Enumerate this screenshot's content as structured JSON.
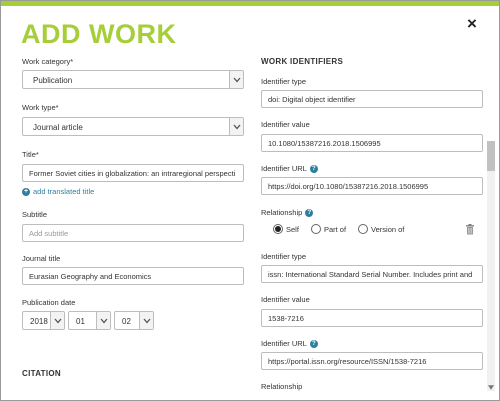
{
  "dialog": {
    "title": "ADD WORK",
    "close_symbol": "×"
  },
  "left": {
    "work_category": {
      "label": "Work category",
      "required_mark": "*",
      "value": "Publication"
    },
    "work_type": {
      "label": "Work type",
      "required_mark": "*",
      "value": "Journal article"
    },
    "title": {
      "label": "Title",
      "required_mark": "*",
      "value": "Former Soviet cities in globalization: an intraregional perspecti"
    },
    "add_translated_title": "add translated title",
    "subtitle": {
      "label": "Subtitle",
      "placeholder": "Add subtitle"
    },
    "journal_title": {
      "label": "Journal title",
      "value": "Eurasian Geography and Economics"
    },
    "publication_date": {
      "label": "Publication date",
      "year": "2018",
      "month": "01",
      "day": "02"
    },
    "citation_heading": "CITATION"
  },
  "right": {
    "heading": "WORK IDENTIFIERS",
    "identifier_1": {
      "type_label": "Identifier type",
      "type_value": "doi: Digital object identifier",
      "value_label": "Identifier value",
      "value": "10.1080/15387216.2018.1506995",
      "url_label": "Identifier URL",
      "url": "https://doi.org/10.1080/15387216.2018.1506995",
      "relationship_label": "Relationship",
      "relationship_options": [
        "Self",
        "Part of",
        "Version of"
      ],
      "relationship_selected": "Self"
    },
    "identifier_2": {
      "type_label": "Identifier type",
      "type_value": "issn: International Standard Serial Number. Includes print and",
      "value_label": "Identifier value",
      "value": "1538-7216",
      "url_label": "Identifier URL",
      "url": "https://portal.issn.org/resource/ISSN/1538-7216",
      "relationship_label": "Relationship"
    }
  },
  "icons": {
    "help": "question-icon",
    "plus": "plus-circle-icon",
    "trash": "trash-icon",
    "chevron": "chevron-down-icon"
  },
  "colors": {
    "accent": "#a6ce39",
    "link": "#2e7f9f"
  }
}
